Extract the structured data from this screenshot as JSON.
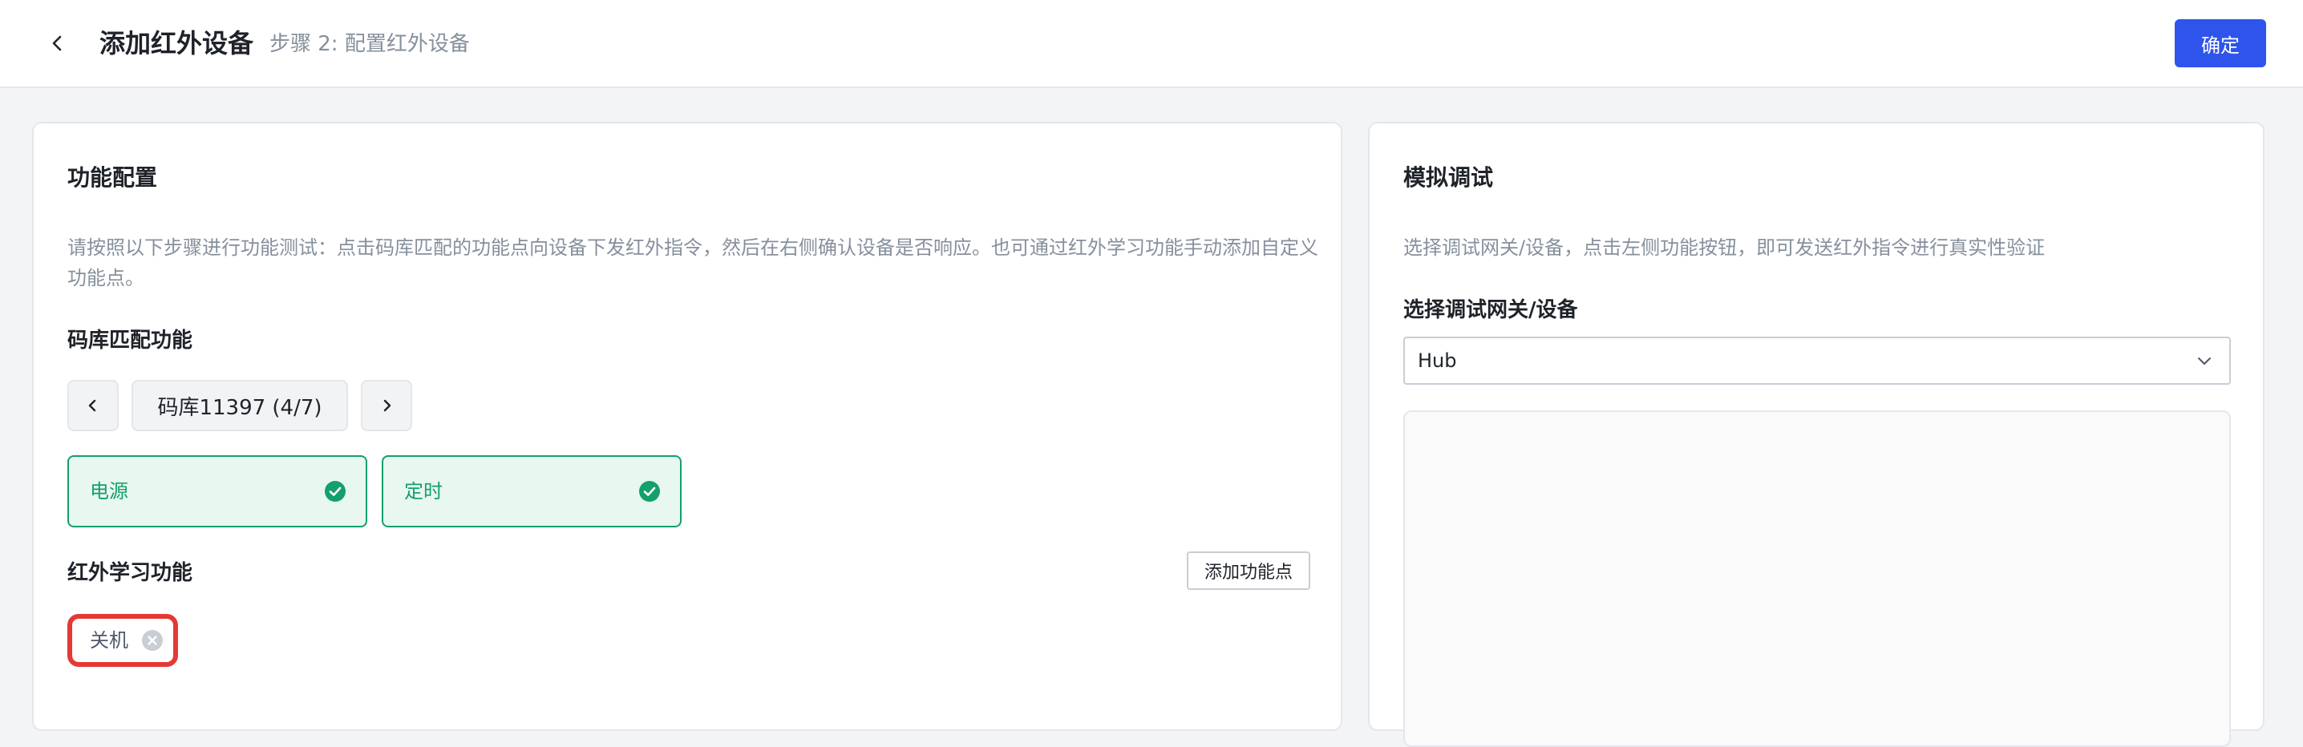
{
  "header": {
    "title": "添加红外设备",
    "step": "步骤 2: 配置红外设备",
    "confirm_label": "确定"
  },
  "left_card": {
    "title": "功能配置",
    "description": "请按照以下步骤进行功能测试：点击码库匹配的功能点向设备下发红外指令，然后在右侧确认设备是否响应。也可通过红外学习功能手动添加自定义功能点。",
    "code_library": {
      "title": "码库匹配功能",
      "current": "码库11397 (4/7)",
      "functions": [
        {
          "label": "电源"
        },
        {
          "label": "定时"
        }
      ]
    },
    "ir_learning": {
      "title": "红外学习功能",
      "add_label": "添加功能点",
      "items": [
        {
          "label": "关机"
        }
      ]
    }
  },
  "right_card": {
    "title": "模拟调试",
    "description": "选择调试网关/设备，点击左侧功能按钮，即可发送红外指令进行真实性验证",
    "select_label": "选择调试网关/设备",
    "select_value": "Hub"
  },
  "colors": {
    "primary": "#2f54eb",
    "success": "#14a06b",
    "success_bg": "#e8f7ef",
    "highlight": "#e53935"
  }
}
